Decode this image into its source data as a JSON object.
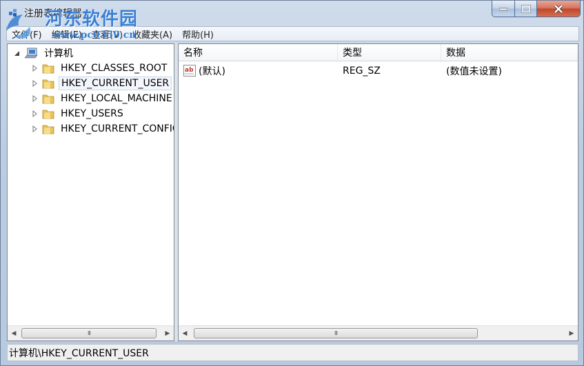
{
  "window": {
    "title": "注册表编辑器",
    "watermark_line1": "河东软件园",
    "watermark_line2": "www.pc0359.cn"
  },
  "menubar": {
    "items": [
      {
        "label": "文件(F)"
      },
      {
        "label": "编辑(E)"
      },
      {
        "label": "查看(V)"
      },
      {
        "label": "收藏夹(A)"
      },
      {
        "label": "帮助(H)"
      }
    ]
  },
  "tree": {
    "root": "计算机",
    "items": [
      {
        "label": "HKEY_CLASSES_ROOT"
      },
      {
        "label": "HKEY_CURRENT_USER"
      },
      {
        "label": "HKEY_LOCAL_MACHINE"
      },
      {
        "label": "HKEY_USERS"
      },
      {
        "label": "HKEY_CURRENT_CONFIG"
      }
    ]
  },
  "list": {
    "columns": {
      "name": "名称",
      "type": "类型",
      "data": "数据"
    },
    "rows": [
      {
        "name": "(默认)",
        "type": "REG_SZ",
        "data": "(数值未设置)"
      }
    ]
  },
  "statusbar": {
    "path": "计算机\\HKEY_CURRENT_USER"
  },
  "colors": {
    "frame": "#bccde2",
    "close_button": "#c0462a",
    "folder": "#e8c25a"
  }
}
